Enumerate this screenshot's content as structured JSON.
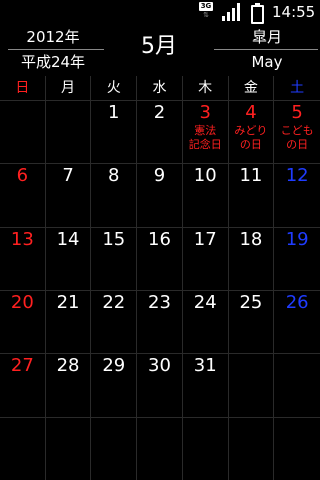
{
  "status_bar": {
    "network": "3G",
    "time": "14:55",
    "icons": [
      "3g-icon",
      "signal-icon",
      "battery-icon"
    ]
  },
  "header": {
    "year": "2012年",
    "era": "平成24年",
    "month": "5月",
    "old_month": "皐月",
    "month_en": "May"
  },
  "colors": {
    "sunday": "#ff2020",
    "saturday": "#1f3cff",
    "weekday": "#ffffff",
    "holiday": "#ff2020",
    "background": "#000000"
  },
  "weekdays": [
    {
      "label": "日",
      "color": "red"
    },
    {
      "label": "月",
      "color": "white"
    },
    {
      "label": "火",
      "color": "white"
    },
    {
      "label": "水",
      "color": "white"
    },
    {
      "label": "木",
      "color": "white"
    },
    {
      "label": "金",
      "color": "white"
    },
    {
      "label": "土",
      "color": "blue"
    }
  ],
  "weeks": [
    [
      {
        "day": "",
        "color": "white",
        "holiday": ""
      },
      {
        "day": "",
        "color": "white",
        "holiday": ""
      },
      {
        "day": "1",
        "color": "white",
        "holiday": ""
      },
      {
        "day": "2",
        "color": "white",
        "holiday": ""
      },
      {
        "day": "3",
        "color": "red",
        "holiday": "憲法\n記念日"
      },
      {
        "day": "4",
        "color": "red",
        "holiday": "みどり\nの日"
      },
      {
        "day": "5",
        "color": "red",
        "holiday": "こども\nの日"
      }
    ],
    [
      {
        "day": "6",
        "color": "red",
        "holiday": ""
      },
      {
        "day": "7",
        "color": "white",
        "holiday": ""
      },
      {
        "day": "8",
        "color": "white",
        "holiday": ""
      },
      {
        "day": "9",
        "color": "white",
        "holiday": ""
      },
      {
        "day": "10",
        "color": "white",
        "holiday": ""
      },
      {
        "day": "11",
        "color": "white",
        "holiday": ""
      },
      {
        "day": "12",
        "color": "blue",
        "holiday": ""
      }
    ],
    [
      {
        "day": "13",
        "color": "red",
        "holiday": ""
      },
      {
        "day": "14",
        "color": "white",
        "holiday": ""
      },
      {
        "day": "15",
        "color": "white",
        "holiday": ""
      },
      {
        "day": "16",
        "color": "white",
        "holiday": ""
      },
      {
        "day": "17",
        "color": "white",
        "holiday": ""
      },
      {
        "day": "18",
        "color": "white",
        "holiday": ""
      },
      {
        "day": "19",
        "color": "blue",
        "holiday": ""
      }
    ],
    [
      {
        "day": "20",
        "color": "red",
        "holiday": ""
      },
      {
        "day": "21",
        "color": "white",
        "holiday": ""
      },
      {
        "day": "22",
        "color": "white",
        "holiday": ""
      },
      {
        "day": "23",
        "color": "white",
        "holiday": ""
      },
      {
        "day": "24",
        "color": "white",
        "holiday": ""
      },
      {
        "day": "25",
        "color": "white",
        "holiday": ""
      },
      {
        "day": "26",
        "color": "blue",
        "holiday": ""
      }
    ],
    [
      {
        "day": "27",
        "color": "red",
        "holiday": ""
      },
      {
        "day": "28",
        "color": "white",
        "holiday": ""
      },
      {
        "day": "29",
        "color": "white",
        "holiday": ""
      },
      {
        "day": "30",
        "color": "white",
        "holiday": ""
      },
      {
        "day": "31",
        "color": "white",
        "holiday": ""
      },
      {
        "day": "",
        "color": "white",
        "holiday": ""
      },
      {
        "day": "",
        "color": "white",
        "holiday": ""
      }
    ],
    [
      {
        "day": "",
        "color": "white",
        "holiday": ""
      },
      {
        "day": "",
        "color": "white",
        "holiday": ""
      },
      {
        "day": "",
        "color": "white",
        "holiday": ""
      },
      {
        "day": "",
        "color": "white",
        "holiday": ""
      },
      {
        "day": "",
        "color": "white",
        "holiday": ""
      },
      {
        "day": "",
        "color": "white",
        "holiday": ""
      },
      {
        "day": "",
        "color": "white",
        "holiday": ""
      }
    ]
  ]
}
